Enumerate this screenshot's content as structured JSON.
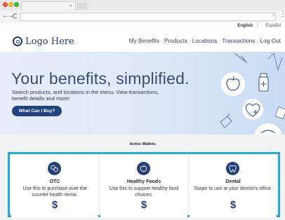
{
  "browser": {
    "tab_close": "×",
    "nav_back": "←",
    "nav_forward": "→",
    "nav_reload": "C",
    "star": "☆",
    "menu": "⋮"
  },
  "language": {
    "english": "English",
    "separator": "|",
    "spanish": "Español"
  },
  "header": {
    "logo_text": "Logo Here",
    "nav": [
      "My Benefits",
      "Products",
      "Locations",
      "Transactions",
      "Log Out"
    ]
  },
  "hero": {
    "title": "Your benefits, simplified.",
    "subtitle": "Search products, and locations in the menu. View transactions, benefit details and more!",
    "cta_label": "What Can I Buy?"
  },
  "wallets": {
    "title": "Active Wallets",
    "accent_color": "#27a8dc",
    "items": [
      {
        "title": "OTC",
        "description": "Use this to purchase over the counter health items.",
        "symbol": "$",
        "icon": "otc-pills-icon"
      },
      {
        "title": "Healthy Foods",
        "description": "Use this to support healthy food choices.",
        "symbol": "$",
        "icon": "apple-icon"
      },
      {
        "title": "Dental",
        "description": "Swipe to use at your dentist's office.",
        "symbol": "$",
        "icon": "tooth-icon"
      }
    ]
  },
  "colors": {
    "brand_navy": "#253f7d",
    "hero_background": "#dde8f7"
  }
}
